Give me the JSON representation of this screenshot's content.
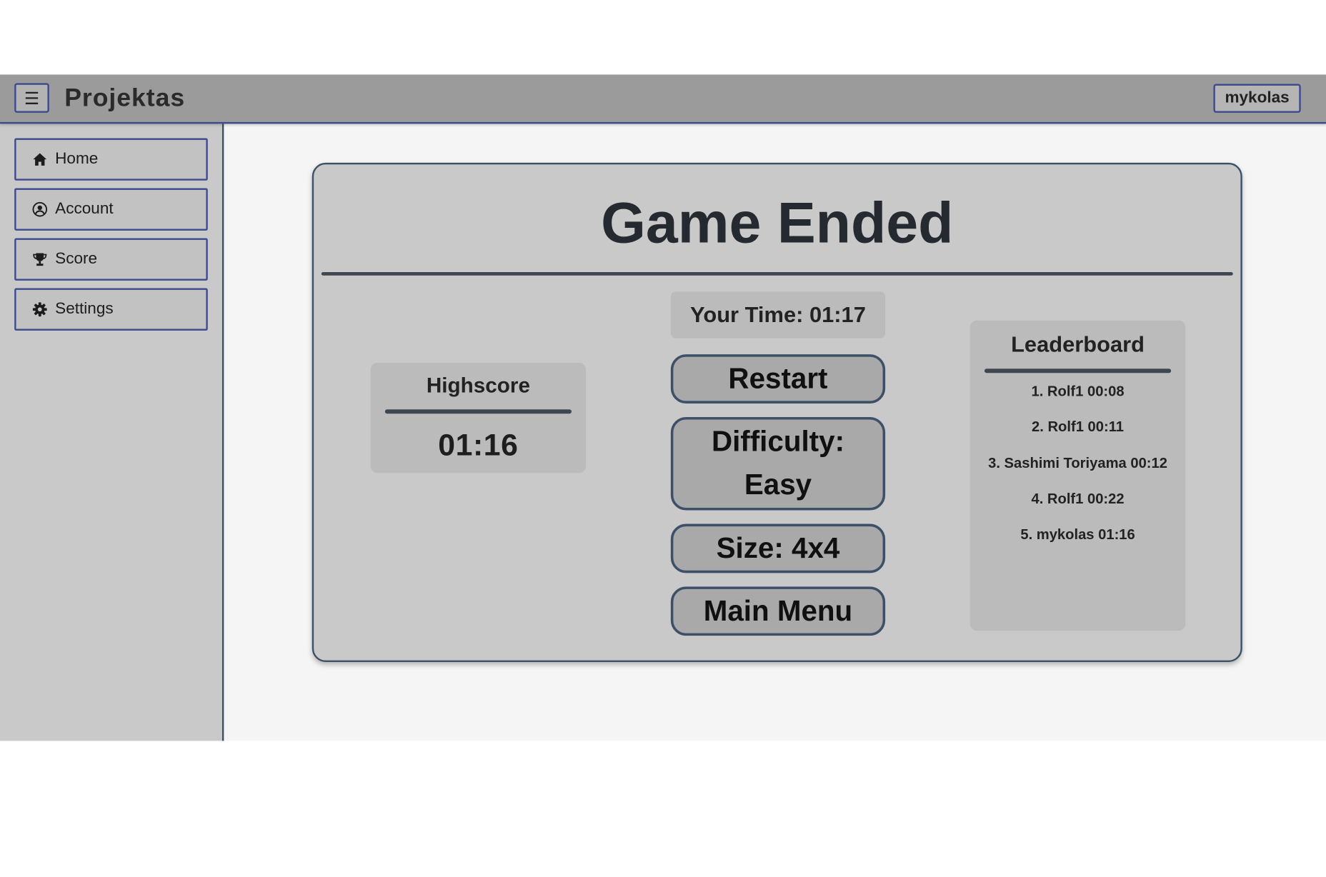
{
  "header": {
    "menu_glyph": "☰",
    "app_title": "Projektas",
    "user_label": "mykolas"
  },
  "sidebar": {
    "items": [
      {
        "label": "Home",
        "icon": "home-icon"
      },
      {
        "label": "Account",
        "icon": "user-circle-icon"
      },
      {
        "label": "Score",
        "icon": "trophy-icon"
      },
      {
        "label": "Settings",
        "icon": "gear-icon"
      }
    ]
  },
  "game": {
    "title": "Game Ended",
    "highscore": {
      "label": "Highscore",
      "value": "01:16"
    },
    "your_time": "Your Time: 01:17",
    "buttons": {
      "restart": "Restart",
      "difficulty_line1": "Difficulty:",
      "difficulty_line2": "Easy",
      "size": "Size: 4x4",
      "main_menu": "Main Menu"
    },
    "leaderboard": {
      "title": "Leaderboard",
      "entries": [
        "1. Rolf1 00:08",
        "2. Rolf1 00:11",
        "3. Sashimi Toriyama 00:12",
        "4. Rolf1 00:22",
        "5. mykolas 01:16"
      ]
    }
  },
  "colors": {
    "header_bg": "#9b9b9b",
    "accent_border": "#3c4a8c",
    "sidebar_bg": "#c9c9c9",
    "content_bg": "#f5f5f5",
    "card_bg": "#c9c9c9",
    "panel_bg": "#bbbbbb",
    "button_bg": "#a9a9a9"
  }
}
